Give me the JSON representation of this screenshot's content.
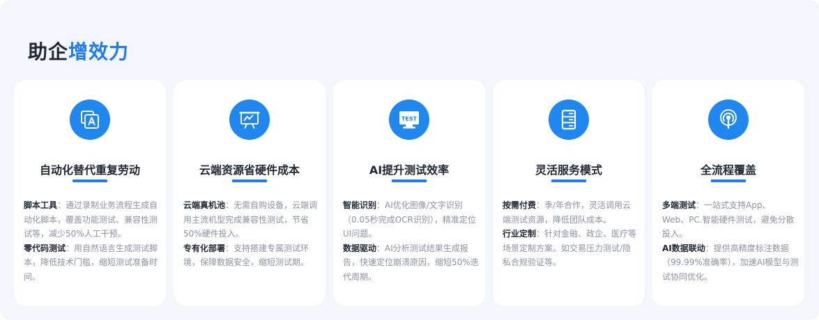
{
  "heading": {
    "part1": "助企",
    "part2": "增效力"
  },
  "colors": {
    "accent": "#1e7bf0",
    "icon_bg": "#1e88f0",
    "panel_bg": "#f3f6fc",
    "text_dark": "#1f2733",
    "text_muted": "#8b93a3"
  },
  "cards": [
    {
      "icon": "a-layers-icon",
      "title": "自动化替代重复劳动",
      "items": [
        {
          "label": "脚本工具",
          "text": "：通过录制业务流程生成自动化脚本，覆盖功能测试、兼容性测试等，减少50%人工干预。"
        },
        {
          "label": "零代码测试",
          "text": "：用自然语言生成测试脚本，降低技术门槛，缩短测试准备时间。"
        }
      ]
    },
    {
      "icon": "presentation-board-icon",
      "title": "云端资源省硬件成本",
      "items": [
        {
          "label": "云端真机池",
          "text": "：无需自购设备，云端调用主流机型完成兼容性测试，节省50%硬件投入。"
        },
        {
          "label": "专有化部署",
          "text": "：支持搭建专属测试环境，保障数据安全，缩短测试期。"
        }
      ]
    },
    {
      "icon": "test-monitor-icon",
      "icon_text": "TEST",
      "title": "AI提升测试效率",
      "items": [
        {
          "label": "智能识别",
          "text": "：AI优化图像/文字识别（0.05秒完成OCR识别），精准定位UI问题。"
        },
        {
          "label": "数据驱动",
          "text": "：AI分析测试结果生成报告，快速定位崩溃原因，缩短50%迭代周期。"
        }
      ]
    },
    {
      "icon": "server-cabinet-icon",
      "title": "灵活服务模式",
      "items": [
        {
          "label": "按需付费",
          "text": "：季/年合作，灵活调用云端测试资源，降低团队成本。"
        },
        {
          "label": "行业定制",
          "text": "：针对金融、政企、医疗等场景定制方案。如交易压力测试/隐私合规验证等。"
        }
      ]
    },
    {
      "icon": "broadcast-signal-icon",
      "title": "全流程覆盖",
      "items": [
        {
          "label": "多端测试",
          "text": "：一站式支持App、 Web、PC.智能硬件测试，避免分散投入。"
        },
        {
          "label": "AI数据联动",
          "text": "：提供高精度标注数据（99.99%准确率），加速AI模型与测试协同优化。"
        }
      ]
    }
  ]
}
